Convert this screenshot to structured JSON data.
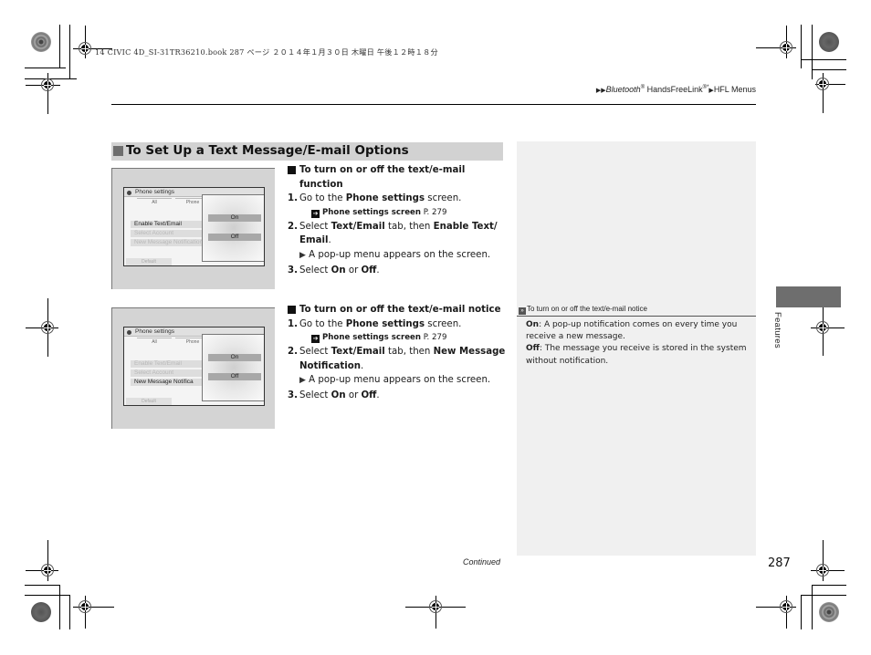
{
  "print_header": "14 CIVIC 4D_SI-31TR36210.book  287 ページ  ２０１４年１月３０日  木曜日  午後１２時１８分",
  "breadcrumb": {
    "items": [
      "Bluetooth",
      "HandsFreeLink",
      "HFL Menus"
    ],
    "marks": [
      "®",
      "®*"
    ]
  },
  "section": {
    "title": "To Set Up a Text Message/E-mail Options"
  },
  "procedures": [
    {
      "heading": "To turn on or off the text/e-mail function",
      "steps": [
        {
          "num": "1.",
          "pre": "Go to the ",
          "bold": "Phone settings",
          "post": " screen."
        },
        {
          "ref_label": "Phone settings screen",
          "ref_page": "P. 279"
        },
        {
          "num": "2.",
          "pre": "Select ",
          "bold": "Text/Email",
          "mid": " tab, then ",
          "bold2": "Enable Text/ Email",
          "post": "."
        },
        {
          "note": "A pop-up menu appears on the screen."
        },
        {
          "num": "3.",
          "pre": "Select ",
          "bold": "On",
          "mid": " or ",
          "bold2": "Off",
          "post": "."
        }
      ],
      "screen": {
        "title": "Phone settings",
        "tabs": [
          "All",
          "Phone"
        ],
        "rows": [
          "Enable Text/Email",
          "Select Account",
          "New Message Notification"
        ],
        "highlighted_row": 0,
        "popup_options": [
          "On",
          "Off"
        ],
        "bottom_button": "Default"
      }
    },
    {
      "heading": "To turn on or off the text/e-mail notice",
      "steps": [
        {
          "num": "1.",
          "pre": "Go to the ",
          "bold": "Phone settings",
          "post": " screen."
        },
        {
          "ref_label": "Phone settings screen",
          "ref_page": "P. 279"
        },
        {
          "num": "2.",
          "pre": "Select ",
          "bold": "Text/Email",
          "mid": " tab, then ",
          "bold2": "New Message Notification",
          "post": "."
        },
        {
          "note": "A pop-up menu appears on the screen."
        },
        {
          "num": "3.",
          "pre": "Select ",
          "bold": "On",
          "mid": " or ",
          "bold2": "Off",
          "post": "."
        }
      ],
      "screen": {
        "title": "Phone settings",
        "tabs": [
          "All",
          "Phone"
        ],
        "rows": [
          "Enable Text/Email",
          "Select Account",
          "New Message Notifica"
        ],
        "highlighted_row": 2,
        "popup_options": [
          "On",
          "Off"
        ],
        "bottom_button": "Default"
      }
    }
  ],
  "side_note": {
    "heading": "To turn on or off the text/e-mail notice",
    "items": [
      {
        "term": "On",
        "text": ": A pop-up notification comes on every time you receive a new message."
      },
      {
        "term": "Off",
        "text": ": The message you receive is stored in the system without notification."
      }
    ]
  },
  "chapter_label": "Features",
  "continued_label": "Continued",
  "page_number": "287",
  "colors": {
    "section_bar": "#d2d2d2",
    "side_panel": "#f0f0f0",
    "chapter_tab": "#6e6e6e"
  }
}
